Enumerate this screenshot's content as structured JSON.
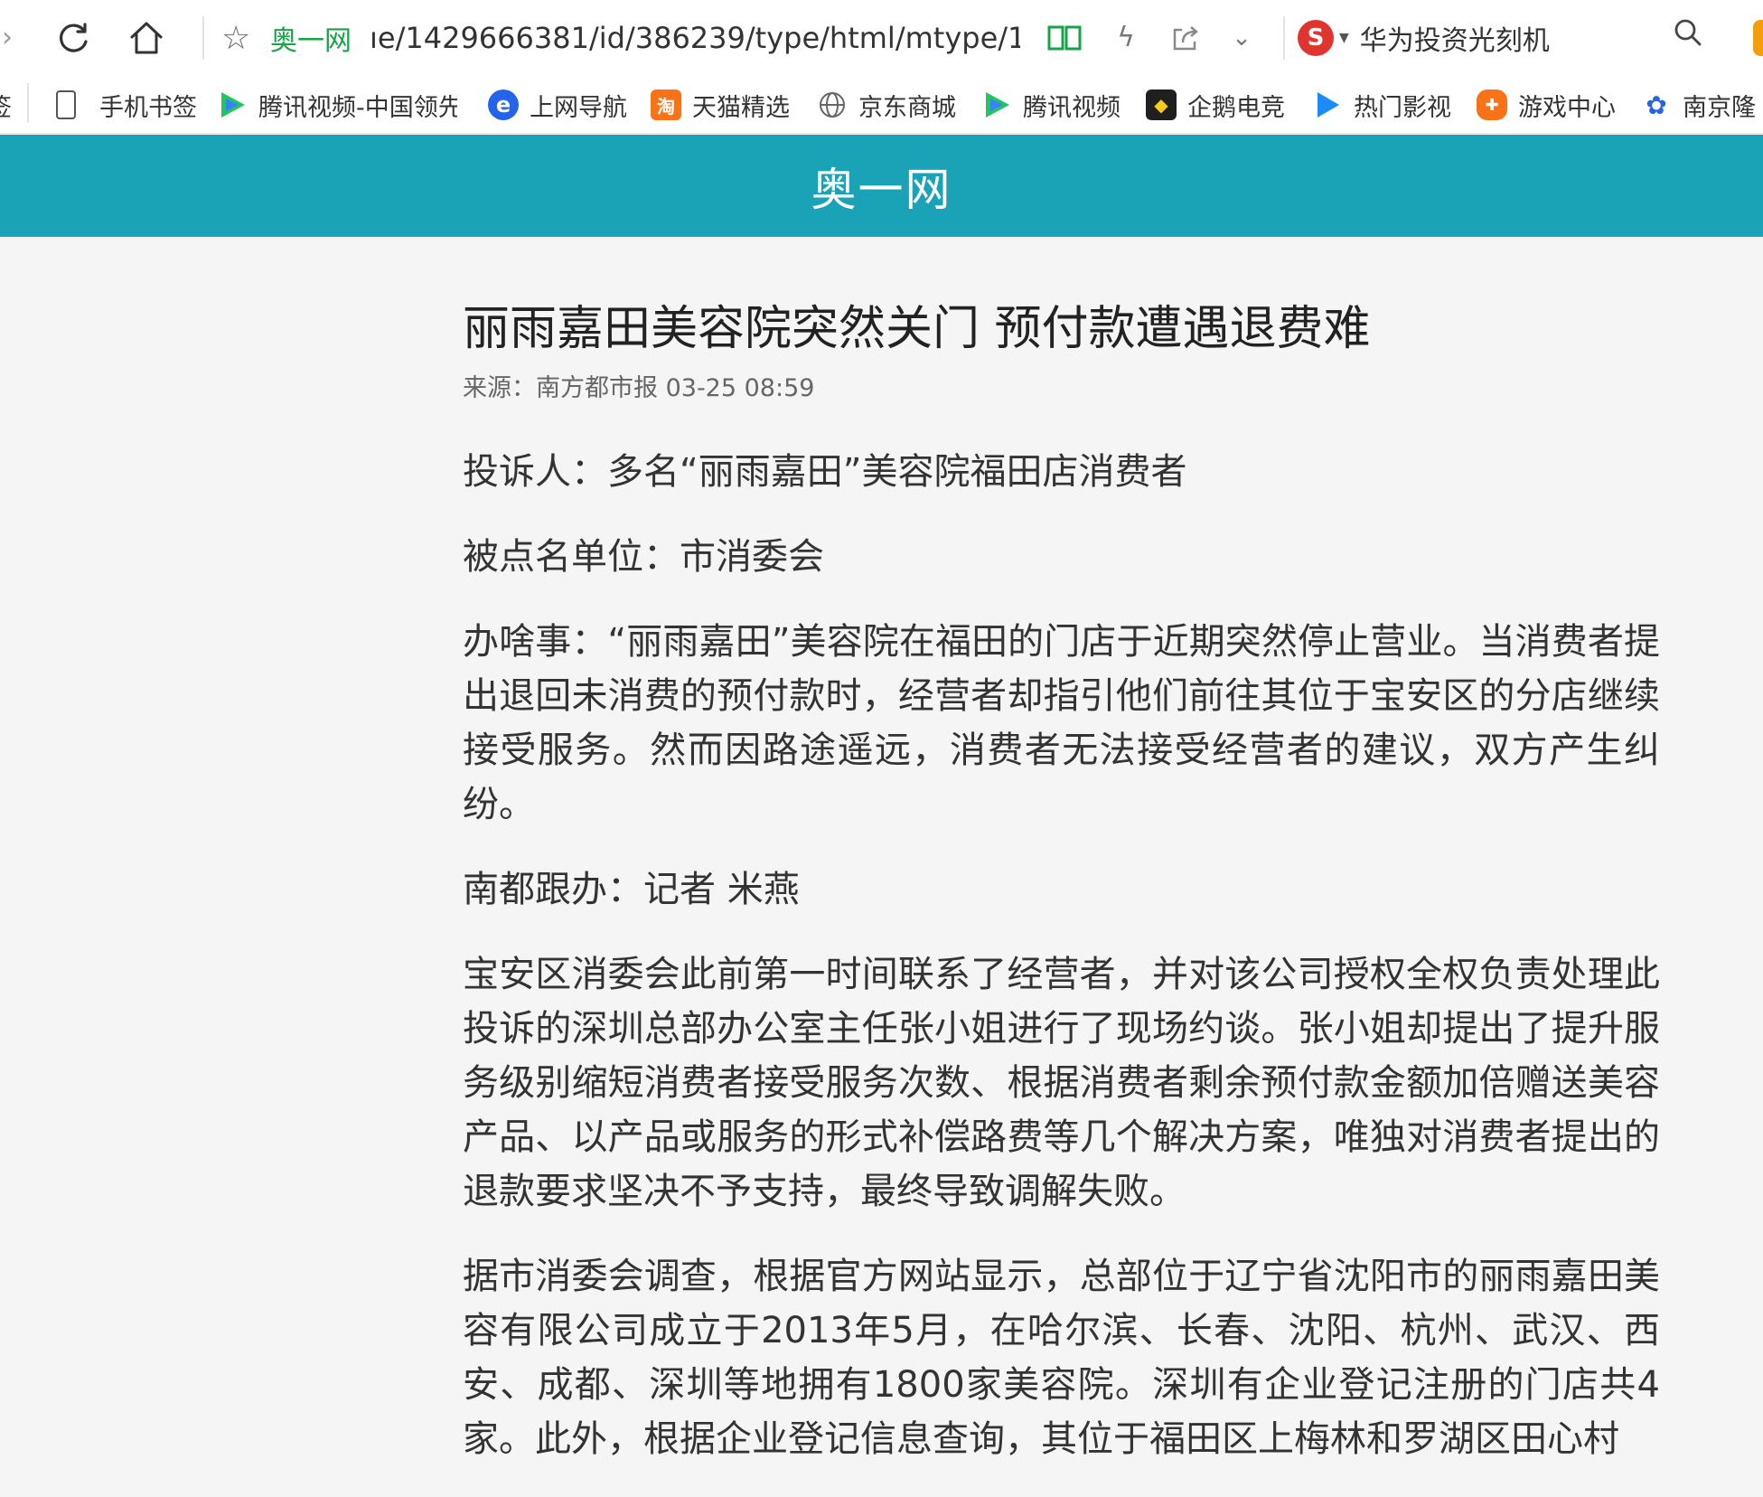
{
  "toolbar": {
    "site_name": "奥一网",
    "url": "ıe/1429666381/id/386239/type/html/mtype/1",
    "search_text": "华为投资光刻机",
    "search_engine_letter": "S"
  },
  "bookmarks": [
    {
      "label": "签",
      "icon": "bookmark-fragment"
    },
    {
      "label": "手机书签",
      "icon": "phone-icon"
    },
    {
      "label": "腾讯视频-中国领先",
      "icon": "tencent-video-icon"
    },
    {
      "label": "上网导航",
      "icon": "ie-icon"
    },
    {
      "label": "天猫精选",
      "icon": "tmall-icon"
    },
    {
      "label": "京东商城",
      "icon": "globe-icon"
    },
    {
      "label": "腾讯视频",
      "icon": "tencent-video-icon"
    },
    {
      "label": "企鹅电竞",
      "icon": "penguin-esports-icon"
    },
    {
      "label": "热门影视",
      "icon": "play-icon"
    },
    {
      "label": "游戏中心",
      "icon": "gamepad-icon"
    },
    {
      "label": "南京隆",
      "icon": "baidu-paw-icon"
    }
  ],
  "header": {
    "site_title": "奥一网"
  },
  "article": {
    "title": "丽雨嘉田美容院突然关门 预付款遭遇退费难",
    "meta": "来源：南方都市报  03-25 08:59",
    "paragraphs": [
      "投诉人：多名“丽雨嘉田”美容院福田店消费者",
      "被点名单位：市消委会",
      "办啥事：“丽雨嘉田”美容院在福田的门店于近期突然停止营业。当消费者提出退回未消费的预付款时，经营者却指引他们前往其位于宝安区的分店继续接受服务。然而因路途遥远，消费者无法接受经营者的建议，双方产生纠纷。",
      "南都跟办：记者 米燕",
      "宝安区消委会此前第一时间联系了经营者，并对该公司授权全权负责处理此投诉的深圳总部办公室主任张小姐进行了现场约谈。张小姐却提出了提升服务级别缩短消费者接受服务次数、根据消费者剩余预付款金额加倍赠送美容产品、以产品或服务的形式补偿路费等几个解决方案，唯独对消费者提出的退款要求坚决不予支持，最终导致调解失败。",
      "据市消委会调查，根据官方网站显示，总部位于辽宁省沈阳市的丽雨嘉田美容有限公司成立于2013年5月，在哈尔滨、长春、沈阳、杭州、武汉、西安、成都、深圳等地拥有1800家美容院。深圳有企业登记注册的门店共4家。此外，根据企业登记信息查询，其位于福田区上梅林和罗湖区田心村"
    ]
  },
  "colors": {
    "header_bg": "#1aa2b6",
    "site_name_green": "#17a34a",
    "search_logo_red": "#e0342e"
  }
}
